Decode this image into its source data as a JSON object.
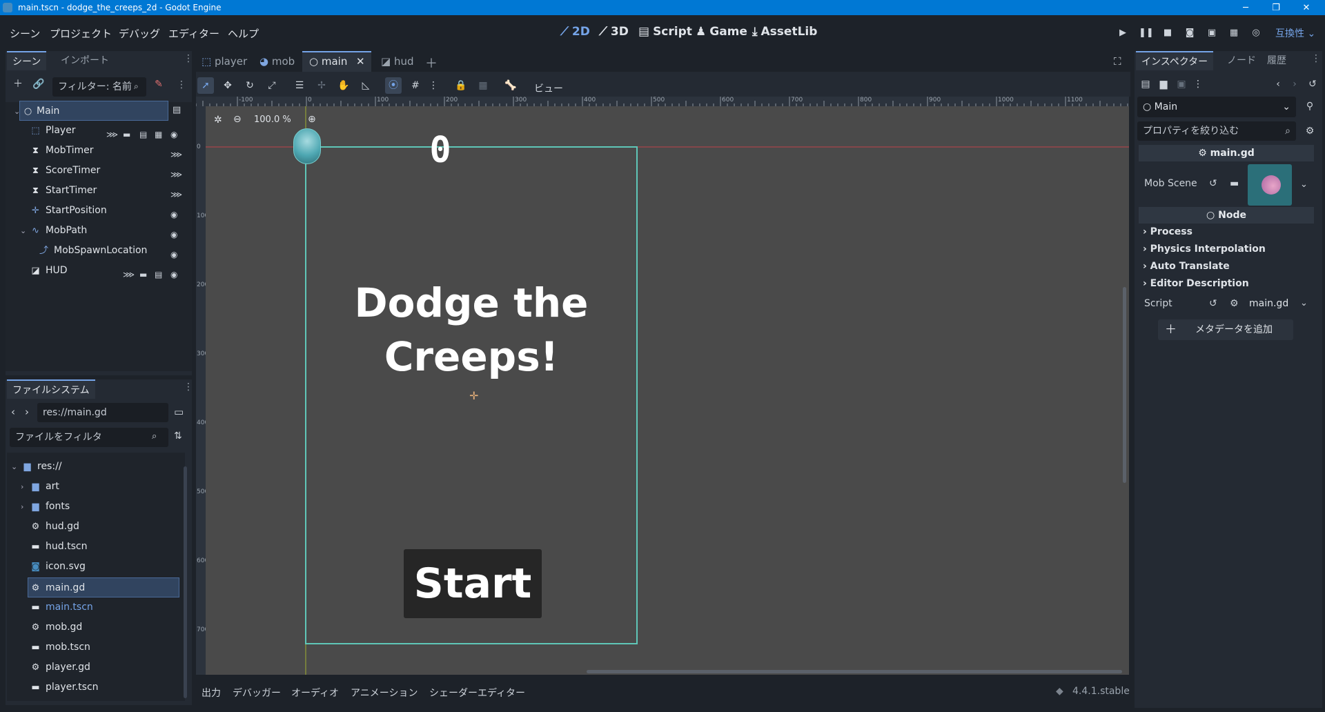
{
  "window": {
    "title": "main.tscn - dodge_the_creeps_2d - Godot Engine",
    "minimize": "─",
    "maximize": "❐",
    "close": "✕"
  },
  "menu": {
    "items": [
      "シーン",
      "プロジェクト",
      "デバッグ",
      "エディター",
      "ヘルプ"
    ]
  },
  "workspaces": {
    "w2d": "2D",
    "w3d": "3D",
    "script": "Script",
    "game": "Game",
    "assetlib": "AssetLib"
  },
  "compat": "互換性",
  "scene_dock": {
    "tabs": [
      "シーン",
      "インポート"
    ],
    "filter_placeholder": "フィルター: 名前",
    "nodes": [
      {
        "label": "Main",
        "icon": "node-icon"
      },
      {
        "label": "Player",
        "icon": "area2d-icon"
      },
      {
        "label": "MobTimer",
        "icon": "timer-icon"
      },
      {
        "label": "ScoreTimer",
        "icon": "timer-icon"
      },
      {
        "label": "StartTimer",
        "icon": "timer-icon"
      },
      {
        "label": "StartPosition",
        "icon": "marker2d-icon"
      },
      {
        "label": "MobPath",
        "icon": "path2d-icon"
      },
      {
        "label": "MobSpawnLocation",
        "icon": "pathfollow-icon"
      },
      {
        "label": "HUD",
        "icon": "canvaslayer-icon"
      }
    ]
  },
  "filesystem": {
    "tab": "ファイルシステム",
    "path": "res://main.gd",
    "filter_placeholder": "ファイルをフィルタ",
    "items": [
      {
        "label": "res://",
        "icon": "folder-icon"
      },
      {
        "label": "art",
        "icon": "folder-icon"
      },
      {
        "label": "fonts",
        "icon": "folder-icon"
      },
      {
        "label": "hud.gd",
        "icon": "script-icon"
      },
      {
        "label": "hud.tscn",
        "icon": "scene-icon"
      },
      {
        "label": "icon.svg",
        "icon": "image-icon"
      },
      {
        "label": "main.gd",
        "icon": "script-icon"
      },
      {
        "label": "main.tscn",
        "icon": "scene-icon"
      },
      {
        "label": "mob.gd",
        "icon": "script-icon"
      },
      {
        "label": "mob.tscn",
        "icon": "scene-icon"
      },
      {
        "label": "player.gd",
        "icon": "script-icon"
      },
      {
        "label": "player.tscn",
        "icon": "scene-icon"
      }
    ]
  },
  "scene_tabs": {
    "player": "player",
    "mob": "mob",
    "main": "main",
    "hud": "hud"
  },
  "toolbar": {
    "view": "ビュー"
  },
  "viewport": {
    "zoom": "100.0 %",
    "score": "0",
    "message_line1": "Dodge the",
    "message_line2": "Creeps!",
    "start": "Start",
    "ruler_labels": [
      "-100",
      "0",
      "100",
      "200",
      "300",
      "400",
      "500",
      "600",
      "700",
      "800",
      "900",
      "1000",
      "1100"
    ],
    "vruler_labels": [
      "0",
      "100",
      "200",
      "300",
      "400",
      "500",
      "600",
      "700"
    ]
  },
  "inspector": {
    "tabs": [
      "インスペクター",
      "ノード",
      "履歴"
    ],
    "node": "Main",
    "filter_placeholder": "プロパティを絞り込む",
    "script_header": "main.gd",
    "mob_scene_label": "Mob Scene",
    "node_section": "Node",
    "categories": [
      "Process",
      "Physics Interpolation",
      "Auto Translate",
      "Editor Description"
    ],
    "script_label": "Script",
    "script_value": "main.gd",
    "add_metadata": "メタデータを追加"
  },
  "bottom": {
    "tabs": [
      "出力",
      "デバッガー",
      "オーディオ",
      "アニメーション",
      "シェーダーエディター"
    ],
    "version": "4.4.1.stable"
  },
  "colors": {
    "accent": "#75a4e8",
    "viewport_bg": "#4a4a4a",
    "path": "#5fc7b8",
    "selection": "#31445f"
  }
}
